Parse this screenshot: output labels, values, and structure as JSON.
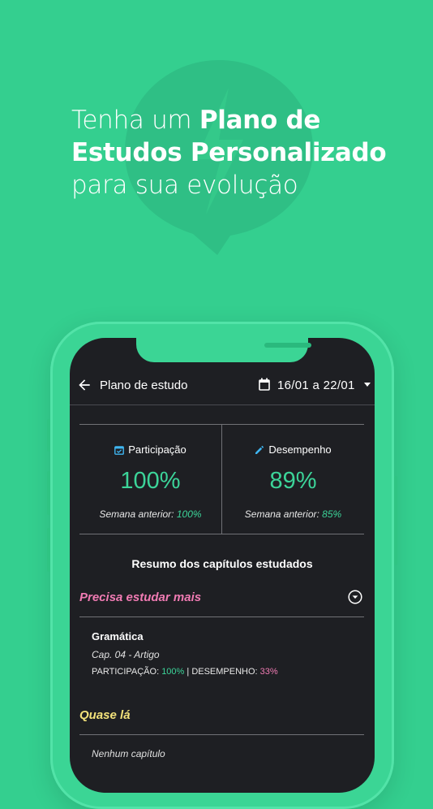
{
  "hero": {
    "line1_light": "Tenha um ",
    "line1_bold": "Plano de",
    "line2_bold": "Estudos Personalizado",
    "line3_light": "para sua evolução"
  },
  "colors": {
    "background": "#34cf8f",
    "screen": "#1e1f23",
    "accent_green": "#3cd499",
    "accent_pink": "#f07bb3",
    "accent_yellow": "#f3e27b",
    "icon_blue": "#3fb5f0"
  },
  "appbar": {
    "back_icon": "arrow-left-icon",
    "title": "Plano de estudo",
    "calendar_icon": "calendar-icon",
    "date_range": "16/01 a 22/01"
  },
  "stats": {
    "participation": {
      "icon": "calendar-check-icon",
      "label": "Participação",
      "value": "100%",
      "prev_label": "Semana anterior: ",
      "prev_value": "100%"
    },
    "performance": {
      "icon": "pencil-icon",
      "label": "Desempenho",
      "value": "89%",
      "prev_label": "Semana anterior: ",
      "prev_value": "85%"
    }
  },
  "summary": {
    "title": "Resumo dos capítulos estudados",
    "needs_more": {
      "title": "Precisa estudar mais",
      "items": [
        {
          "name": "Gramática",
          "chapter": "Cap. 04 - Artigo",
          "participation_label": "PARTICIPAÇÃO: ",
          "participation_value": "100%",
          "separator": " | ",
          "performance_label": "DESEMPENHO: ",
          "performance_value": "33%"
        }
      ]
    },
    "almost": {
      "title": "Quase lá",
      "empty_text": "Nenhum capítulo"
    }
  }
}
